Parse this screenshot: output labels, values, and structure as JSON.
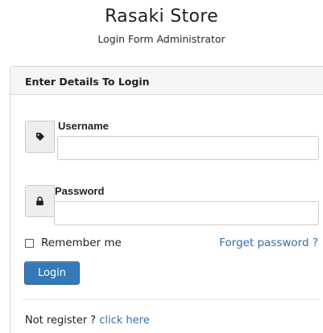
{
  "header": {
    "title": "Rasaki Store",
    "subtitle": "Login Form Administrator"
  },
  "panel": {
    "heading": "Enter Details To Login"
  },
  "username": {
    "label": "Username",
    "value": "",
    "icon": "tag-icon"
  },
  "password": {
    "label": "Password",
    "value": "",
    "icon": "lock-icon"
  },
  "remember": {
    "label": "Remember me",
    "checked": false
  },
  "forget": {
    "label": "Forget password ?"
  },
  "login": {
    "label": "Login"
  },
  "register": {
    "prefix": "Not register ?",
    "link_label": "click here"
  },
  "colors": {
    "primary": "#337ab7",
    "link": "#2f6fad"
  }
}
